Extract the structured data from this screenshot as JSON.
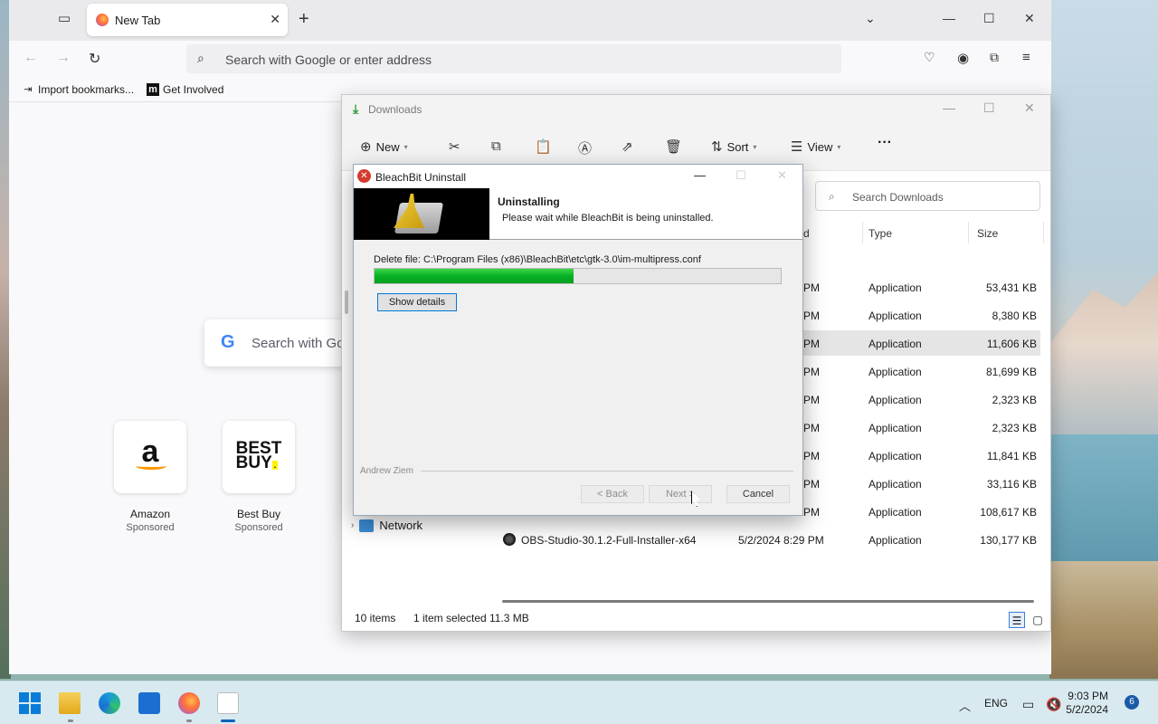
{
  "browser": {
    "tab_title": "New Tab",
    "url_placeholder": "Search with Google or enter address",
    "bookmarks": [
      "Import bookmarks...",
      "Get Involved"
    ],
    "search_placeholder": "Search with Go",
    "shortcuts": [
      {
        "name": "Amazon",
        "sub": "Sponsored"
      },
      {
        "name": "Best Buy",
        "sub": "Sponsored"
      }
    ]
  },
  "explorer": {
    "title": "Downloads",
    "toolbar": {
      "new": "New",
      "sort": "Sort",
      "view": "View",
      "more": "···"
    },
    "search_placeholder": "Search Downloads",
    "columns": {
      "date_partial": "d",
      "type": "Type",
      "size": "Size"
    },
    "rows": [
      {
        "name": "",
        "date": "PM",
        "type": "Application",
        "size": "53,431 KB",
        "selected": false
      },
      {
        "name": "",
        "date": "PM",
        "type": "Application",
        "size": "8,380 KB",
        "selected": false
      },
      {
        "name": "",
        "date": "PM",
        "type": "Application",
        "size": "11,606 KB",
        "selected": true
      },
      {
        "name": "",
        "date": "PM",
        "type": "Application",
        "size": "81,699 KB",
        "selected": false
      },
      {
        "name": "",
        "date": "PM",
        "type": "Application",
        "size": "2,323 KB",
        "selected": false
      },
      {
        "name": "",
        "date": "PM",
        "type": "Application",
        "size": "2,323 KB",
        "selected": false
      },
      {
        "name": "",
        "date": "PM",
        "type": "Application",
        "size": "11,841 KB",
        "selected": false
      },
      {
        "name": "",
        "date": "PM",
        "type": "Application",
        "size": "33,116 KB",
        "selected": false
      },
      {
        "name": "",
        "date": "PM",
        "type": "Application",
        "size": "108,617 KB",
        "selected": false
      },
      {
        "name": "OBS-Studio-30.1.2-Full-Installer-x64",
        "date": "5/2/2024 8:29 PM",
        "type": "Application",
        "size": "130,177 KB",
        "selected": false
      }
    ],
    "nav_network": "Network",
    "status": {
      "items": "10 items",
      "selected": "1 item selected",
      "size": "11.3 MB"
    }
  },
  "dialog": {
    "title": "BleachBit Uninstall",
    "heading": "Uninstalling",
    "subheading": "Please wait while BleachBit is being uninstalled.",
    "status_text": "Delete file: C:\\Program Files (x86)\\BleachBit\\etc\\gtk-3.0\\im-multipress.conf",
    "progress": 0.49,
    "show_details": "Show details",
    "author": "Andrew Ziem",
    "back": "< Back",
    "next": "Next >",
    "cancel": "Cancel"
  },
  "taskbar": {
    "lang": "ENG",
    "time": "9:03 PM",
    "date": "5/2/2024",
    "notifications": "6"
  }
}
